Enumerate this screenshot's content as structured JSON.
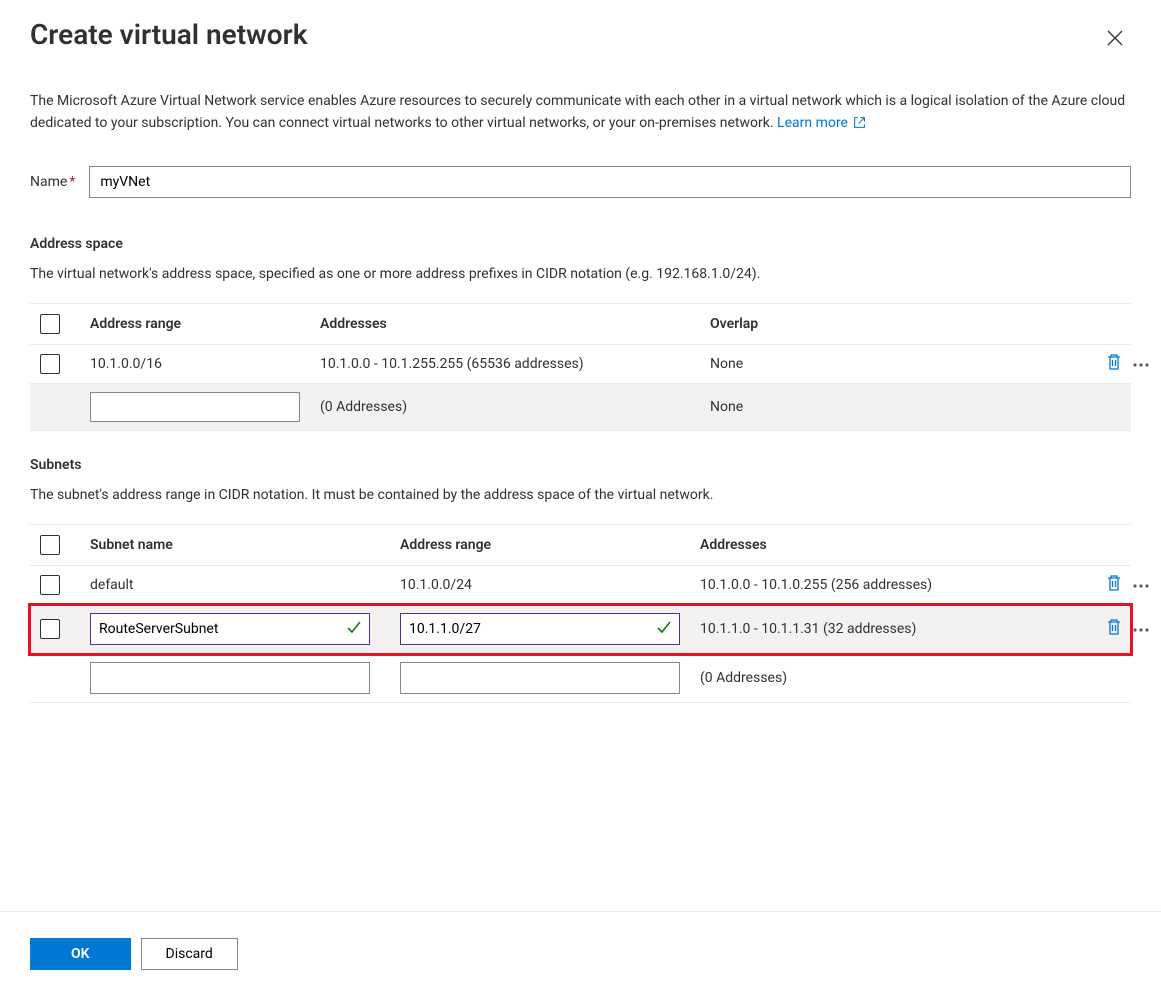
{
  "header": {
    "title": "Create virtual network"
  },
  "description": {
    "text": "The Microsoft Azure Virtual Network service enables Azure resources to securely communicate with each other in a virtual network which is a logical isolation of the Azure cloud dedicated to your subscription. You can connect virtual networks to other virtual networks, or your on-premises network.",
    "learn_more": "Learn more"
  },
  "name_field": {
    "label": "Name",
    "value": "myVNet"
  },
  "address_space": {
    "title": "Address space",
    "description": "The virtual network's address space, specified as one or more address prefixes in CIDR notation (e.g. 192.168.1.0/24).",
    "columns": {
      "range": "Address range",
      "addresses": "Addresses",
      "overlap": "Overlap"
    },
    "rows": [
      {
        "range": "10.1.0.0/16",
        "addresses": "10.1.0.0 - 10.1.255.255 (65536 addresses)",
        "overlap": "None"
      }
    ],
    "new_row": {
      "range": "",
      "addresses": "(0 Addresses)",
      "overlap": "None"
    }
  },
  "subnets": {
    "title": "Subnets",
    "description": "The subnet's address range in CIDR notation. It must be contained by the address space of the virtual network.",
    "columns": {
      "name": "Subnet name",
      "range": "Address range",
      "addresses": "Addresses"
    },
    "rows": [
      {
        "name": "default",
        "range": "10.1.0.0/24",
        "addresses": "10.1.0.0 - 10.1.0.255 (256 addresses)"
      },
      {
        "name": "RouteServerSubnet",
        "range": "10.1.1.0/27",
        "addresses": "10.1.1.0 - 10.1.1.31 (32 addresses)"
      }
    ],
    "new_row": {
      "name": "",
      "range": "",
      "addresses": "(0 Addresses)"
    }
  },
  "footer": {
    "ok": "OK",
    "discard": "Discard"
  }
}
